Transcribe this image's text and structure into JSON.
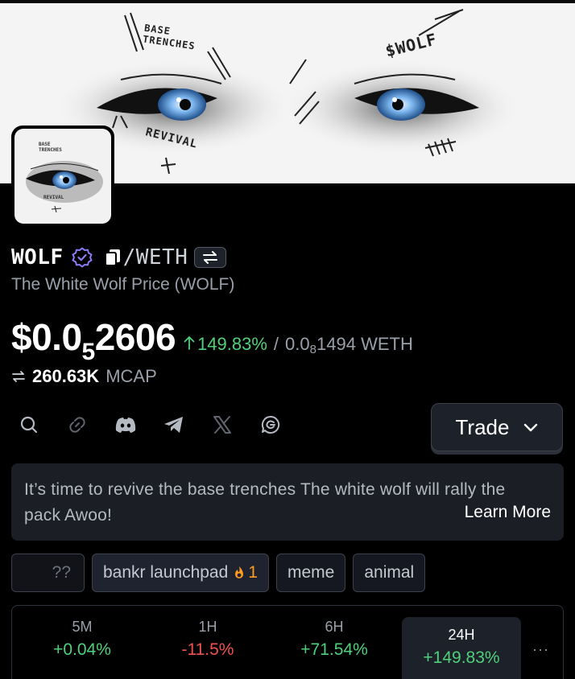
{
  "banner": {
    "text_base": "BASE",
    "text_trenches": "TRENCHES",
    "text_ticker": "$WOLF",
    "text_revival": "REVIVAL"
  },
  "avatar": {
    "text_base": "BASE",
    "text_trenches": "TRENCHES",
    "text_revival": "REVIVAL"
  },
  "token": {
    "symbol": "WOLF",
    "pair": "/WETH",
    "subtitle": "The White Wolf Price (WOLF)"
  },
  "price": {
    "prefix": "$0.0",
    "zeros_subscript": "5",
    "digits": "2606",
    "change": "149.83%",
    "separator": "/",
    "weth_prefix": "0.0",
    "weth_subscript": "8",
    "weth_digits": "1494",
    "weth_unit": "WETH"
  },
  "mcap": {
    "value": "260.63K",
    "label": "MCAP"
  },
  "socials": [
    "search-icon",
    "link-icon",
    "discord-icon",
    "telegram-icon",
    "x-icon",
    "chat-icon"
  ],
  "trade": {
    "label": "Trade"
  },
  "description": {
    "text": "It’s time to revive the base trenches The white wolf will rally the pack Awoo!",
    "learn_more": "Learn More"
  },
  "tags": [
    {
      "label": "??"
    },
    {
      "label": "bankr launchpad",
      "count": "1"
    },
    {
      "label": "meme"
    },
    {
      "label": "animal"
    }
  ],
  "stats": [
    {
      "label": "5M",
      "value": "+0.04%",
      "direction": "up"
    },
    {
      "label": "1H",
      "value": "-11.5%",
      "direction": "down"
    },
    {
      "label": "6H",
      "value": "+71.54%",
      "direction": "up"
    },
    {
      "label": "24H",
      "value": "+149.83%",
      "direction": "up",
      "selected": true
    }
  ],
  "stats_more": "···",
  "colors": {
    "positive": "#4fd07a",
    "negative": "#f0524f",
    "verified": "#8b7cf6",
    "flame": "#ff9c1f"
  }
}
